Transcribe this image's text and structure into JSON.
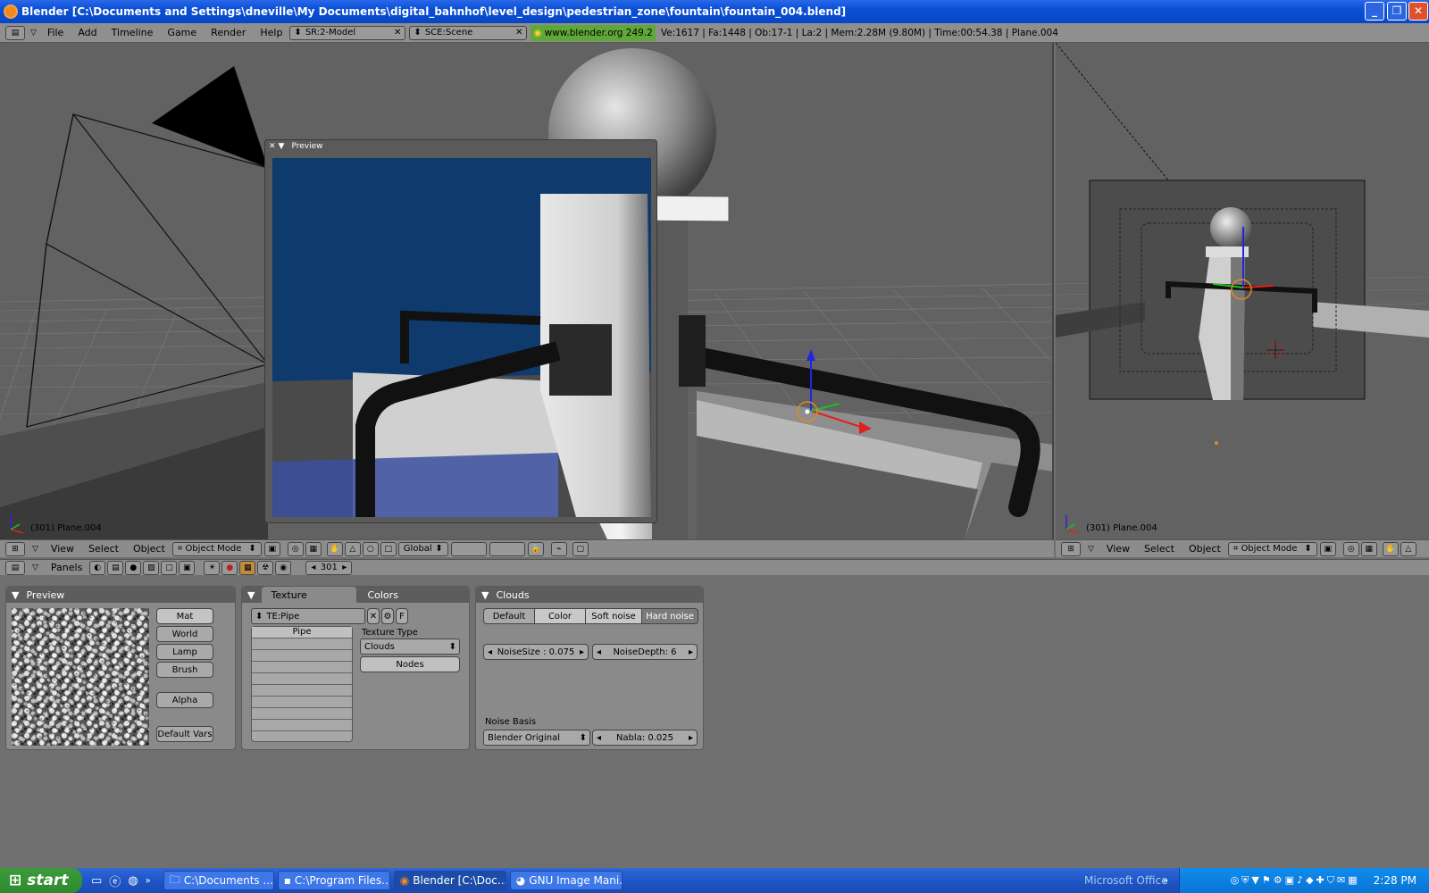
{
  "window": {
    "title": "Blender [C:\\Documents and Settings\\dneville\\My Documents\\digital_bahnhof\\level_design\\pedestrian_zone\\fountain\\fountain_004.blend]",
    "controls": [
      "_",
      "❐",
      "✕"
    ]
  },
  "menubar": {
    "menus": [
      "File",
      "Add",
      "Timeline",
      "Game",
      "Render",
      "Help"
    ],
    "screen_field": "SR:2-Model",
    "scene_field": "SCE:Scene",
    "website": "www.blender.org 249.2",
    "stats": "Ve:1617 | Fa:1448 | Ob:17-1 | La:2  | Mem:2.28M (9.80M)  | Time:00:54.38 | Plane.004"
  },
  "viewport_main": {
    "preview_title": "Preview",
    "object_label": "(301) Plane.004",
    "header": {
      "menus": [
        "View",
        "Select",
        "Object"
      ],
      "mode": "Object Mode",
      "orientation": "Global"
    }
  },
  "viewport_camera": {
    "object_label": "(301) Plane.004",
    "header": {
      "menus": [
        "View",
        "Select",
        "Object"
      ],
      "mode": "Object Mode"
    }
  },
  "buttons_header": {
    "label": "Panels",
    "frame": "301"
  },
  "preview_panel": {
    "title": "Preview",
    "buttons": [
      "Mat",
      "World",
      "Lamp",
      "Brush"
    ],
    "alpha": "Alpha",
    "default_vars": "Default Vars"
  },
  "texture_panel": {
    "tab_texture": "Texture",
    "tab_colors": "Colors",
    "texture_name": "TE:Pipe",
    "f_button": "F",
    "list_items": [
      "Pipe"
    ],
    "texture_type_label": "Texture Type",
    "texture_type": "Clouds",
    "nodes": "Nodes"
  },
  "clouds_panel": {
    "title": "Clouds",
    "buttons": [
      "Default",
      "Color",
      "Soft noise",
      "Hard noise"
    ],
    "noise_size": "NoiseSize : 0.075",
    "noise_depth": "NoiseDepth: 6",
    "noise_basis_label": "Noise Basis",
    "noise_basis": "Blender Original",
    "nabla": "Nabla: 0.025"
  },
  "taskbar": {
    "start": "start",
    "tasks": [
      "C:\\Documents ...",
      "C:\\Program Files...",
      "Blender [C:\\Doc...",
      "GNU Image Mani..."
    ],
    "tray_label": "Microsoft Office",
    "clock": "2:28 PM"
  },
  "colors": {
    "titlebar": "#0a4fd8",
    "viewport": "#626262",
    "preview_blue": "#0e3a6e",
    "website_green": "#5fa838"
  }
}
